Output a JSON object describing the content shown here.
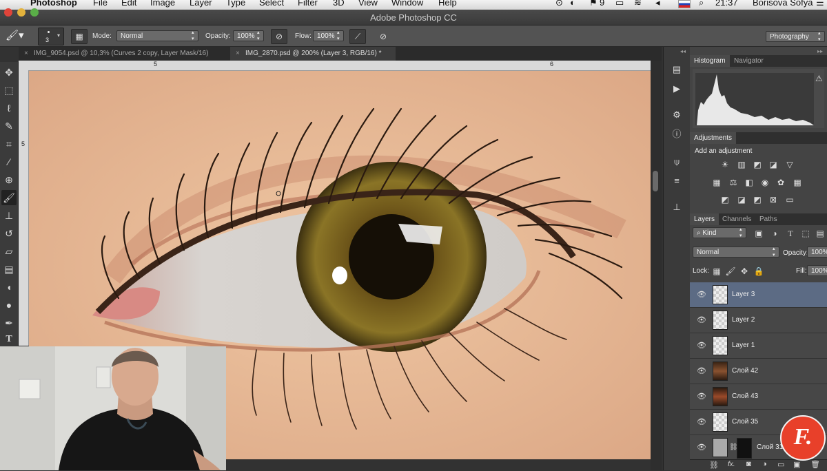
{
  "menubar": {
    "app": "Photoshop",
    "items": [
      "File",
      "Edit",
      "Image",
      "Layer",
      "Type",
      "Select",
      "Filter",
      "3D",
      "View",
      "Window",
      "Help"
    ],
    "status_num": "9",
    "clock": "21:37",
    "user": "Borisova Sofya"
  },
  "window": {
    "title": "Adobe Photoshop CC"
  },
  "options": {
    "brush_size": "3",
    "mode_label": "Mode:",
    "mode_value": "Normal",
    "opacity_label": "Opacity:",
    "opacity_value": "100%",
    "flow_label": "Flow:",
    "flow_value": "100%",
    "workspace": "Photography"
  },
  "tabs": [
    {
      "label": "IMG_9054.psd @ 10,3% (Curves 2 copy, Layer Mask/16)"
    },
    {
      "label": "IMG_2870.psd @ 200% (Layer 3, RGB/16) *"
    }
  ],
  "rulers": {
    "top": [
      "5",
      "6"
    ],
    "left": [
      "5"
    ]
  },
  "histogram_panel": {
    "tabs": [
      "Histogram",
      "Navigator"
    ]
  },
  "adjustments_panel": {
    "tab": "Adjustments",
    "hint": "Add an adjustment"
  },
  "layers_panel": {
    "tabs": [
      "Layers",
      "Channels",
      "Paths"
    ],
    "filter_kind": "Kind",
    "blend_mode": "Normal",
    "opacity_label": "Opacity:",
    "opacity_value": "100%",
    "lock_label": "Lock:",
    "fill_label": "Fill:",
    "fill_value": "100%",
    "layers": [
      {
        "name": "Layer 3"
      },
      {
        "name": "Layer 2"
      },
      {
        "name": "Layer 1"
      },
      {
        "name": "Слой 42"
      },
      {
        "name": "Слой 43"
      },
      {
        "name": "Слой 35"
      },
      {
        "name": "Слой 31"
      }
    ],
    "footer": {
      "fx": "fx."
    }
  },
  "watermark": {
    "logo_text": "F."
  },
  "colors": {
    "selected_layer": "#5c6b84",
    "watermark": "#e8402a"
  }
}
